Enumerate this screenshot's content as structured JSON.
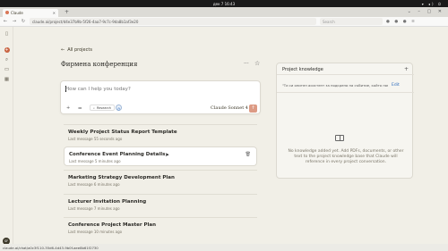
{
  "os": {
    "clock": "дек 7  16:43",
    "tray": "▾ ◂) ⏻"
  },
  "browser": {
    "tab_title": "Claude",
    "url": "claude.ai/project/d4e37b9b-5f26-4aa7-9c7c-9da8b1af3e20",
    "search_placeholder": "Search",
    "extensions": "● ● ● ≡"
  },
  "rail": {
    "avatar_initials": "SF"
  },
  "main": {
    "back_label": "All projects",
    "project_title": "Фирмена конференция",
    "composer": {
      "placeholder": "How can I help you today?",
      "research_label": "Research",
      "model_label": "Claude Sonnet 4"
    },
    "chats": [
      {
        "name": "Weekly Project Status Report Template",
        "meta": "Last message 55 seconds ago"
      },
      {
        "name": "Conference Event Planning Details",
        "meta": "Last message 5 minutes ago"
      },
      {
        "name": "Marketing Strategy Development Plan",
        "meta": "Last message 6 minutes ago"
      },
      {
        "name": "Lecturer Invitation Planning",
        "meta": "Last message 7 minutes ago"
      },
      {
        "name": "Conference Project Master Plan",
        "meta": "Last message 10 minutes ago"
      }
    ]
  },
  "knowledge": {
    "title": "Project knowledge",
    "instructions": "\"Ти си опитен асистент за подкрепа на събитие, който пом...",
    "edit_label": "Edit",
    "empty_text": "No knowledge added yet. Add PDFs, documents, or other text to the project knowledge base that Claude will reference in every project conversation."
  },
  "status_url": "claude.ai/chat/a0c3f110-35d6-4d43-9b0f-aee8b61f2730",
  "colors": {
    "accent": "#c96442",
    "send": "#dc9a84",
    "link": "#2d6bbd"
  }
}
